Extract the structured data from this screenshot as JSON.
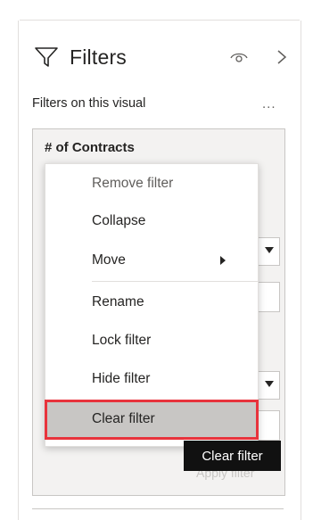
{
  "pane": {
    "title": "Filters",
    "icons": {
      "filter": "filter-icon",
      "visibility": "eye-icon",
      "collapse": "chevron-right-icon"
    }
  },
  "section": {
    "title": "Filters on this visual",
    "more": "..."
  },
  "card": {
    "title": "# of Contracts",
    "apply_label": "Apply filter"
  },
  "context_menu": {
    "items": [
      {
        "label": "Remove filter",
        "disabled": true
      },
      {
        "label": "Collapse"
      },
      {
        "label": "Move",
        "has_submenu": true
      },
      {
        "label": "Rename"
      },
      {
        "label": "Lock filter"
      },
      {
        "label": "Hide filter"
      },
      {
        "label": "Clear filter",
        "highlighted": true
      }
    ]
  },
  "tooltip": {
    "text": "Clear filter"
  },
  "colors": {
    "highlight_border": "#e8333c",
    "hover_bg": "#c8c6c4",
    "tooltip_bg": "#111111"
  }
}
